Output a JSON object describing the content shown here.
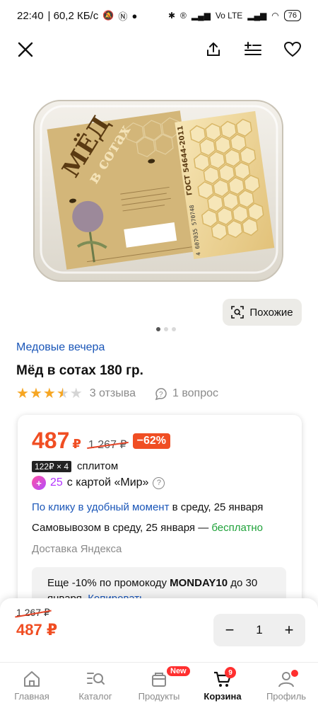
{
  "status_bar": {
    "time": "22:40",
    "speed": "| 60,2 КБ/с",
    "battery": "76",
    "net1": "Vo LTE"
  },
  "header": {
    "close_icon": "close-icon",
    "share_icon": "share-icon",
    "compare_icon": "list-add-icon",
    "favorite_icon": "heart-icon"
  },
  "gallery": {
    "similar_label": "Похожие",
    "image_current": 1,
    "image_count": 3,
    "package_texts": {
      "brand_line1": "МЁД",
      "brand_line2": "в сотах",
      "gost": "ГОСТ 54644-2011",
      "barcode": "4 607035 570748"
    }
  },
  "product": {
    "brand": "Медовые вечера",
    "title": "Мёд в сотах 180 гр.",
    "rating": 3.5,
    "reviews": "3 отзыва",
    "questions": "1 вопрос"
  },
  "offer": {
    "price": "487",
    "currency": "₽",
    "old_price": "1 267 ₽",
    "discount": "−62%",
    "split_badge": "122₽ × 4",
    "split_label": "сплитом",
    "mir_amount": "25",
    "mir_label": "с картой «Мир»",
    "delivery_link": "По клику в удобный момент",
    "delivery_date": " в среду, 25 января",
    "pickup_text": "Самовывозом в среду, 25 января — ",
    "pickup_free": "бесплатно",
    "delivery_service": "Доставка Яндекса",
    "promo_prefix": "Еще -10% по промокоду ",
    "promo_code": "MONDAY10",
    "promo_suffix": " до 30 января. ",
    "promo_copy": "Копировать"
  },
  "buy_bar": {
    "old_price": "1 267 ₽",
    "price": "487 ₽",
    "quantity": "1",
    "minus": "−",
    "plus": "+"
  },
  "tabs": [
    {
      "label": "Главная",
      "icon": "home-icon"
    },
    {
      "label": "Каталог",
      "icon": "catalog-search-icon"
    },
    {
      "label": "Продукты",
      "icon": "grocery-icon",
      "badge": "New"
    },
    {
      "label": "Корзина",
      "icon": "cart-icon",
      "badge": "9"
    },
    {
      "label": "Профиль",
      "icon": "profile-icon"
    }
  ],
  "colors": {
    "accent_price": "#f04e23",
    "link": "#1a56b8",
    "free": "#1fa23a",
    "star": "#f6a623"
  }
}
